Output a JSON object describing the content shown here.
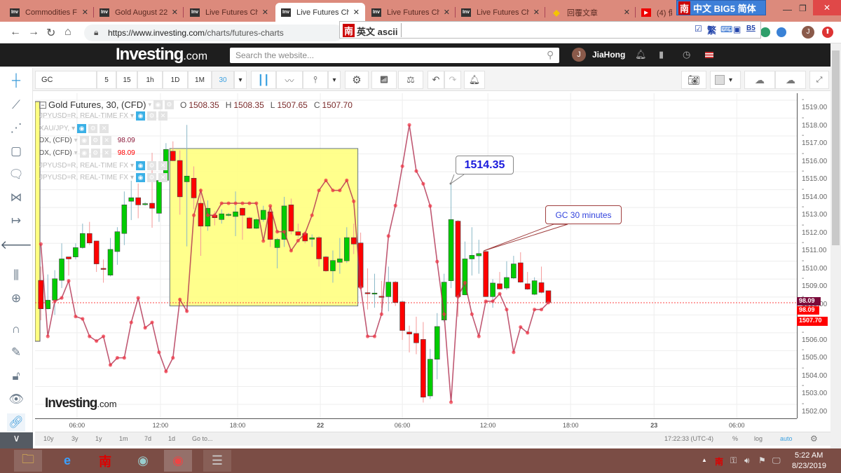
{
  "browser": {
    "tabs": [
      {
        "title": "Commodities F",
        "icon": "inv"
      },
      {
        "title": "Gold August 22",
        "icon": "inv"
      },
      {
        "title": "Live Futures Ch",
        "icon": "inv"
      },
      {
        "title": "Live Futures Ch",
        "icon": "inv",
        "active": true
      },
      {
        "title": "Live Futures Ch",
        "icon": "inv"
      },
      {
        "title": "Live Futures Ch",
        "icon": "inv"
      },
      {
        "title": "回覆文章",
        "icon": "gem"
      },
      {
        "title": "(4) 倒",
        "icon": "youtube"
      }
    ],
    "fav_label": "Inv",
    "close_glyph": "✕",
    "url_host": "https://www.investing.com",
    "url_path": "/charts/futures-charts",
    "profile_initial": "J"
  },
  "ime": {
    "top": {
      "nan": "南",
      "mode": "中文 BIG5 简体"
    },
    "bar": {
      "nan": "南",
      "mode": "英文 ascii",
      "trad": "繁",
      "b5": "B5"
    }
  },
  "site": {
    "logo": "Investing",
    "logo_suffix": ".com",
    "search_placeholder": "Search the website...",
    "user_initial": "J",
    "user_name": "JiaHong"
  },
  "toolbar": {
    "symbol": "GC",
    "intervals": [
      "5",
      "15",
      "1h",
      "1D",
      "1M",
      "30"
    ],
    "active_interval": "30"
  },
  "legend": {
    "main_title": "Gold Futures, 30, (CFD)",
    "ohlc": {
      "o_label": "O",
      "o": "1508.35",
      "h_label": "H",
      "h": "1508.35",
      "l_label": "L",
      "l": "1507.65",
      "c_label": "C",
      "c": "1507.70"
    },
    "studies": [
      {
        "name": "JPYUSD=R, REAL-TIME FX",
        "value": ""
      },
      {
        "name": "XAU/JPY,",
        "value": ""
      },
      {
        "name": "DX, (CFD)",
        "value": "98.09"
      },
      {
        "name": "DX, (CFD)",
        "value": "98.09"
      },
      {
        "name": "JPYUSD=R, REAL-TIME FX",
        "value": ""
      },
      {
        "name": "JPYUSD=R, REAL-TIME FX",
        "value": ""
      }
    ]
  },
  "annotations": {
    "price_callout": "1514.35",
    "text_callout": "GC 30 minutes"
  },
  "price_tags": {
    "dx1": "98.09",
    "dx2": "98.09",
    "last": "1507.70"
  },
  "watermark": {
    "logo": "Investing",
    "suffix": ".com"
  },
  "bottom": {
    "ranges": [
      "10y",
      "3y",
      "1y",
      "1m",
      "7d",
      "1d",
      "Go to..."
    ],
    "time": "17:22:33 (UTC-4)",
    "pct": "%",
    "log": "log",
    "auto": "auto"
  },
  "taskbar": {
    "time": "5:22 AM",
    "date": "8/23/2019"
  },
  "colors": {
    "up": "#00cc00",
    "down": "#ff0000",
    "overlay": "#b03050",
    "highlight": "#ffff80",
    "tab_bar": "#dc8a7c",
    "taskbar": "#7b4d45"
  },
  "chart_data": {
    "type": "candlestick",
    "title": "Gold Futures, 30, (CFD)",
    "ylim": [
      1501.6,
      1519.4
    ],
    "y_ticks": [
      "1519.00",
      "1518.00",
      "1517.00",
      "1516.00",
      "1515.00",
      "1514.00",
      "1513.00",
      "1512.00",
      "1511.00",
      "1510.00",
      "1509.00",
      "1508.00",
      "1507.00",
      "1506.00",
      "1505.00",
      "1504.00",
      "1503.00",
      "1502.00"
    ],
    "x_ticks": [
      "06:00",
      "12:00",
      "18:00",
      "22",
      "06:00",
      "12:00",
      "18:00",
      "23",
      "06:00"
    ],
    "x_tick_bar_index": [
      5.2,
      17.2,
      28.3,
      40.2,
      52.0,
      64.3,
      76.2,
      88.2,
      100.1
    ],
    "ohlc": [
      [
        1508.93,
        1509.7,
        1506.7,
        1507.34
      ],
      [
        1507.34,
        1509.26,
        1507.3,
        1507.82
      ],
      [
        1507.82,
        1509.5,
        1507.0,
        1509.02
      ],
      [
        1508.93,
        1511.0,
        1508.5,
        1510.13
      ],
      [
        1510.24,
        1510.24,
        1509.2,
        1510.13
      ],
      [
        1510.24,
        1511.0,
        1510.1,
        1510.76
      ],
      [
        1510.76,
        1512.1,
        1510.7,
        1511.55
      ],
      [
        1511.55,
        1512.2,
        1510.9,
        1511.02
      ],
      [
        1511.13,
        1511.13,
        1509.4,
        1509.85
      ],
      [
        1509.6,
        1510.1,
        1508.8,
        1509.55
      ],
      [
        1509.22,
        1511.3,
        1509.15,
        1510.66
      ],
      [
        1510.54,
        1511.9,
        1509.8,
        1511.65
      ],
      [
        1511.55,
        1513.9,
        1510.9,
        1513.15
      ],
      [
        1513.35,
        1514.5,
        1512.3,
        1513.55
      ],
      [
        1513.55,
        1514.35,
        1512.4,
        1513.15
      ],
      [
        1513.2,
        1513.3,
        1513.1,
        1513.22
      ],
      [
        1513.24,
        1516.06,
        1511.87,
        1512.96
      ],
      [
        1512.68,
        1514.9,
        1512.2,
        1514.51
      ],
      [
        1514.52,
        1516.6,
        1514.5,
        1516.25
      ],
      [
        1516.15,
        1516.7,
        1515.6,
        1515.62
      ],
      [
        1515.63,
        1516.2,
        1512.6,
        1513.6
      ],
      [
        1514.44,
        1517.62,
        1510.83,
        1514.76
      ],
      [
        1514.64,
        1515.3,
        1512.9,
        1513.54
      ],
      [
        1513.24,
        1514.0,
        1510.3,
        1511.96
      ],
      [
        1511.96,
        1513.4,
        1511.7,
        1512.96
      ],
      [
        1512.57,
        1512.8,
        1512.0,
        1512.43
      ],
      [
        1512.33,
        1512.9,
        1512.1,
        1512.65
      ],
      [
        1512.6,
        1512.7,
        1512.5,
        1512.62
      ],
      [
        1512.5,
        1513.9,
        1511.4,
        1512.76
      ],
      [
        1512.96,
        1513.0,
        1511.2,
        1512.57
      ],
      [
        1512.42,
        1512.5,
        1511.8,
        1511.84
      ],
      [
        1511.84,
        1512.4,
        1511.8,
        1512.33
      ],
      [
        1512.33,
        1513.1,
        1512.2,
        1512.85
      ],
      [
        1512.76,
        1513.0,
        1510.8,
        1511.22
      ],
      [
        1510.76,
        1511.3,
        1509.6,
        1511.22
      ],
      [
        1511.22,
        1513.6,
        1510.8,
        1513.09
      ],
      [
        1513.15,
        1513.5,
        1511.5,
        1511.68
      ],
      [
        1511.65,
        1512.1,
        1511.3,
        1511.45
      ],
      [
        1511.55,
        1511.6,
        1511.0,
        1511.13
      ],
      [
        1511.23,
        1511.5,
        1510.8,
        1511.31
      ],
      [
        1511.32,
        1511.4,
        1509.7,
        1510.13
      ],
      [
        1510.24,
        1510.3,
        1509.4,
        1509.46
      ],
      [
        1509.46,
        1510.6,
        1508.8,
        1510.04
      ],
      [
        1509.94,
        1511.3,
        1509.3,
        1510.13
      ],
      [
        1510.02,
        1511.9,
        1509.9,
        1511.32
      ],
      [
        1511.32,
        1512.1,
        1510.4,
        1510.96
      ],
      [
        1511.02,
        1511.6,
        1508.5,
        1508.54
      ],
      [
        1508.24,
        1509.6,
        1507.3,
        1508.2
      ],
      [
        1508.18,
        1509.3,
        1507.4,
        1508.22
      ],
      [
        1508.04,
        1508.9,
        1507.4,
        1508.0
      ],
      [
        1508.02,
        1509.7,
        1507.2,
        1508.83
      ],
      [
        1508.83,
        1508.9,
        1507.5,
        1507.69
      ],
      [
        1507.73,
        1507.8,
        1505.6,
        1506.13
      ],
      [
        1506.04,
        1506.4,
        1504.9,
        1505.93
      ],
      [
        1505.96,
        1506.9,
        1504.8,
        1505.44
      ],
      [
        1505.63,
        1506.6,
        1502.1,
        1502.4
      ],
      [
        1502.47,
        1505.1,
        1502.3,
        1504.52
      ],
      [
        1504.52,
        1507.1,
        1503.4,
        1506.35
      ],
      [
        1506.71,
        1509.3,
        1506.6,
        1508.83
      ],
      [
        1508.91,
        1514.35,
        1508.5,
        1512.33
      ],
      [
        1512.24,
        1512.3,
        1506.9,
        1508.02
      ],
      [
        1508.12,
        1511.1,
        1508.1,
        1510.13
      ],
      [
        1510.13,
        1511.9,
        1509.2,
        1510.33
      ],
      [
        1510.3,
        1511.2,
        1509.3,
        1510.43
      ],
      [
        1510.54,
        1510.6,
        1508.0,
        1508.02
      ],
      [
        1508.02,
        1509.0,
        1507.4,
        1508.78
      ],
      [
        1508.74,
        1509.4,
        1508.4,
        1508.45
      ],
      [
        1508.5,
        1510.0,
        1508.4,
        1509.09
      ],
      [
        1509.06,
        1510.3,
        1509.0,
        1509.85
      ],
      [
        1509.91,
        1510.5,
        1508.8,
        1508.83
      ],
      [
        1508.74,
        1509.4,
        1508.4,
        1508.44
      ],
      [
        1508.15,
        1509.1,
        1508.1,
        1508.91
      ],
      [
        1508.8,
        1509.7,
        1508.2,
        1508.26
      ],
      [
        1508.35,
        1508.35,
        1507.65,
        1507.7
      ]
    ],
    "overlay_series": {
      "name": "DX, (CFD)",
      "last_value": 98.09,
      "values_in_price_axis_units": [
        1510.96,
        1505.8,
        1507.76,
        1507.95,
        1508.9,
        1506.91,
        1506.78,
        1505.8,
        1505.54,
        1505.8,
        1504.2,
        1504.6,
        1504.6,
        1506.58,
        1507.95,
        1506.28,
        1506.58,
        1504.91,
        1503.84,
        1504.6,
        1507.86,
        1507.21,
        1512.57,
        1513.96,
        1512.57,
        1512.57,
        1513.24,
        1513.24,
        1513.24,
        1513.24,
        1513.24,
        1513.24,
        1511.13,
        1513.09,
        1511.65,
        1511.65,
        1510.59,
        1511.15,
        1511.55,
        1512.57,
        1513.96,
        1514.52,
        1513.96,
        1513.96,
        1514.52,
        1513.35,
        1508.54,
        1505.8,
        1505.8,
        1507.04,
        1511.41,
        1513.11,
        1515.31,
        1517.62,
        1515.04,
        1514.33,
        1513.09,
        1509.98,
        1507.04,
        1502.12,
        1508.02,
        1508.8,
        1507.04,
        1505.8,
        1507.76,
        1507.76,
        1508.18,
        1507.3,
        1504.91,
        1506.32,
        1506.0,
        1507.3,
        1507.3,
        1507.69
      ]
    },
    "dx_level": 1507.68,
    "highlight_box": {
      "from_bar": 19,
      "to_bar": 46,
      "top": 1516.3,
      "bottom": 1507.5
    },
    "grid": true
  }
}
